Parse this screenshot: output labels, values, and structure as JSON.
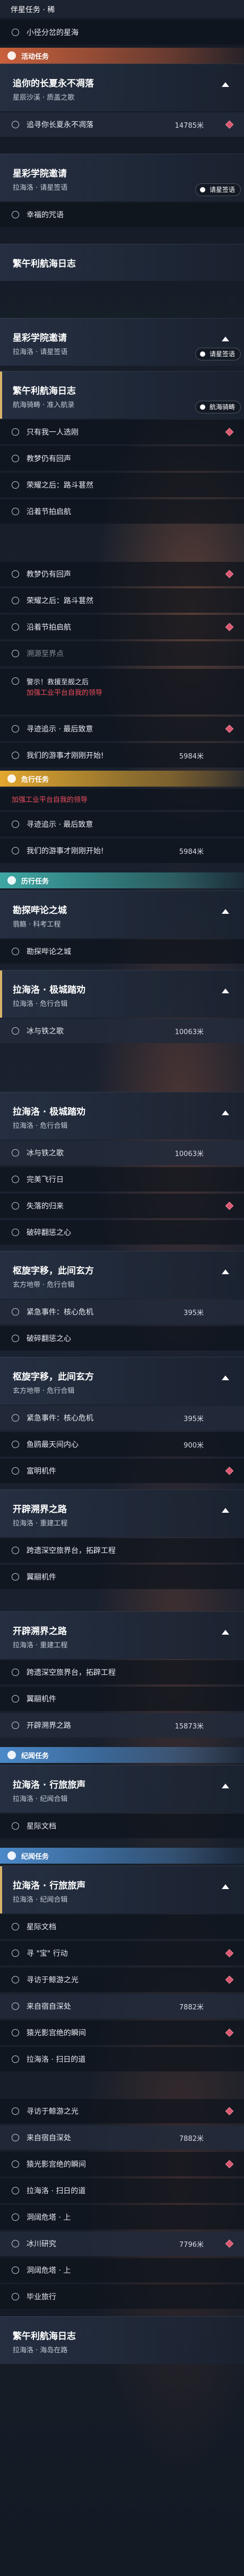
{
  "title_strip": "伴星任务 · 稀",
  "rows_label": {
    "star_sea": "小径分岔的星海",
    "pursue": "追寻你长夏永不凋落",
    "rainbow": "冠星学院邀请",
    "lucky": "幸福的咒语",
    "treaty": "繁午利航海日志",
    "only_one": "只有我一人选刚",
    "sequence": "教梦仍有回声",
    "glory": "荣耀之后：路斗葚然",
    "dawn": "沿着节拍启航",
    "drown": "溯源至界点",
    "fail1": "警示！救援至舰之后",
    "fail2": "加强工业平台自我的领导",
    "find": "寻迹追示 · 最后致意",
    "rally": "我们的游事才刚刚开始!",
    "thought": "勘探哔论之城",
    "inner": "拉海洛 · 极城踏劝",
    "ice": "冰与铁之歌",
    "purple": "完美飞行日",
    "mirror": "失落的归来",
    "sink": "破碎翻惩之心",
    "spin": "枢旋字移，此间玄方",
    "urgent": "紧急事件：核心危机",
    "shoal": "鱼鸥最天间内心",
    "hood": "富明机件",
    "open": "开辟溯界之路",
    "cross": "跨遗深空旅界台，拓辟工程",
    "wing": "翼翮机件",
    "abyss": "拉海洛 · 行旅旅声",
    "star_dream": "星际文档",
    "gold": "寻 \"宝\" 行动",
    "hunt": "寻访于鲸游之光",
    "suntown": "来自宿自深处",
    "mirage": "猿光影宫绝的瞬间",
    "moon": "拉海洛 · 扫日的道",
    "hatch": "洞阔危塔 · 上",
    "refine": "冰川研究",
    "prayer": "毕业旅行"
  },
  "categories": {
    "activity": "活动任务",
    "danger": "危行任务",
    "journey": "历行任务",
    "chrono": "纪闻任务"
  },
  "cards": {
    "c1_t": "追你的长夏永不凋落",
    "c1_s": "星辰沙溪 · 质盖之歌",
    "c2_t": "星彩学院邀请",
    "c2_s": "拉海洛 · 请星签语",
    "c3_t": "繁午利航海日志",
    "c4_t": "星彩学院邀请",
    "c4_s": "拉海洛 · 请星签语",
    "c5_t": "繁午利航海日志",
    "c5_s": "航海骑畴 · 准入航录",
    "c6_t": "勘探哔论之城",
    "c6_s": "翡觞 · 科考工程",
    "c7_t": "拉海洛 · 极城踏劝",
    "c7_s": "拉海洛 · 危行合辑",
    "c8_t": "拉海洛 · 极城踏劝",
    "c8_s": "拉海洛 · 危行合辑",
    "c9_t": "枢旋字移，此间玄方",
    "c9_s": "玄方地带 · 危行合辑",
    "c10_t": "枢旋字移，此间玄方",
    "c10_s": "玄方地带 · 危行合辑",
    "c11_t": "开辟溯界之路",
    "c11_s": "拉海洛 · 重建工程",
    "c12_t": "开辟溯界之路",
    "c12_s": "拉海洛 · 重建工程",
    "c13_t": "拉海洛 · 行旅旅声",
    "c13_s": "拉海洛 · 纪闻合辑",
    "c14_t": "拉海洛 · 行旅旅声",
    "c14_s": "拉海洛 · 纪闻合辑",
    "c15_t": "繁午利航海日志",
    "c15_s": "拉海洛 · 海岛在路",
    "badge": "请星签语",
    "badge2": "航海骑畴"
  },
  "distances": {
    "d1": "14785米",
    "d2": "5984米",
    "d3": "5984米",
    "d4": "10063米",
    "d5": "10063米",
    "d6": "395米",
    "d7": "395米",
    "d8": "900米",
    "d9": "15873米",
    "d10": "7882米",
    "d11": "7882米",
    "d12": "7796米"
  },
  "colors": {
    "activity": "#c9603c",
    "danger": "#e2a72e",
    "journey": "#3ea7a3",
    "chrono": "#4b89c9",
    "alert": "#f04d5e",
    "marker": "#d9566e"
  }
}
